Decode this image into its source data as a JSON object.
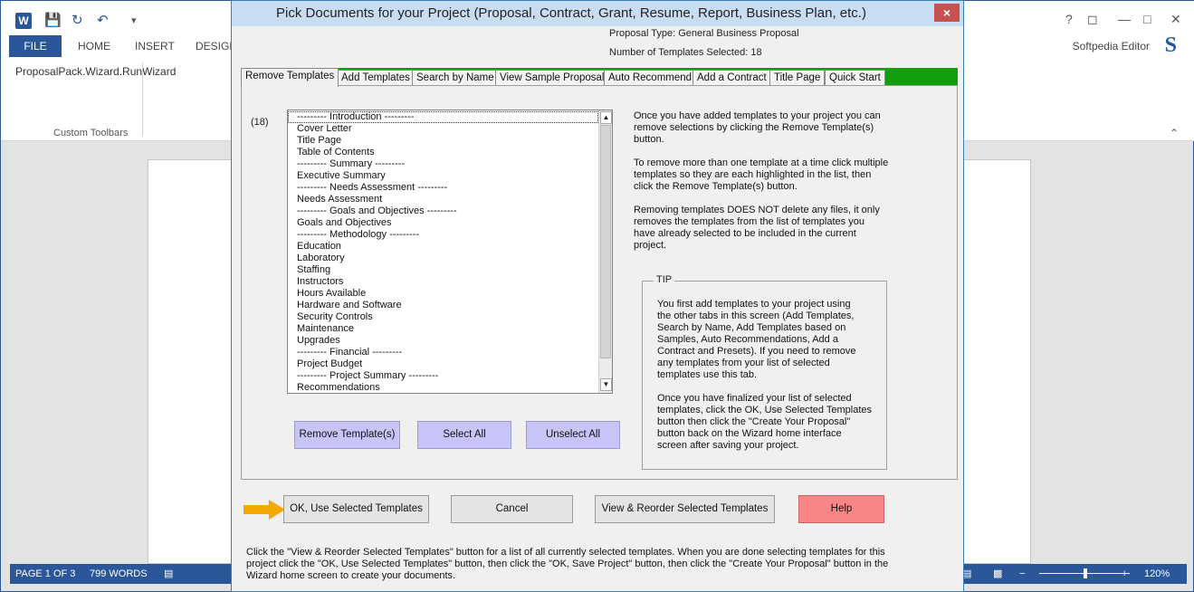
{
  "word": {
    "tabs": [
      "FILE",
      "HOME",
      "INSERT",
      "DESIGN"
    ],
    "user_name": "Softpedia Editor",
    "s_logo": "S",
    "toolbar_item": "ProposalPack.Wizard.RunWizard",
    "group_label": "Custom Toolbars",
    "status": {
      "page": "PAGE 1 OF 3",
      "words": "799 WORDS",
      "zoom": "120%"
    }
  },
  "dialog": {
    "title": "Pick Documents for your Project (Proposal, Contract, Grant, Resume, Report, Business Plan, etc.)",
    "close_label": "×",
    "proposal_type": "Proposal Type: General Business Proposal",
    "templates_selected": "Number of Templates Selected: 18",
    "tabs": [
      "Remove Templates",
      "Add Templates",
      "Search by Name",
      "View Sample Proposals",
      "Auto Recommend",
      "Add a Contract",
      "Title Page",
      "Quick Start"
    ],
    "count_label": "(18)",
    "list_items": [
      "--------- Introduction ---------",
      "Cover Letter",
      "Title Page",
      "Table of Contents",
      "--------- Summary ---------",
      "Executive Summary",
      "--------- Needs Assessment ---------",
      "Needs Assessment",
      "--------- Goals and Objectives ---------",
      "Goals and Objectives",
      "--------- Methodology ---------",
      "Education",
      "Laboratory",
      "Staffing",
      "Instructors",
      "Hours Available",
      "Hardware and Software",
      "Security Controls",
      "Maintenance",
      "Upgrades",
      "--------- Financial ---------",
      "Project Budget",
      "--------- Project Summary ---------",
      "Recommendations"
    ],
    "buttons": {
      "remove": "Remove Template(s)",
      "select_all": "Select All",
      "unselect_all": "Unselect All"
    },
    "help_paragraphs": [
      [
        "Once you have added templates to your project you can",
        "remove selections by clicking the Remove Template(s)",
        "button."
      ],
      [
        "To remove more than one template at a time click multiple",
        "templates so they are each highlighted in the list, then",
        "click the Remove Template(s) button."
      ],
      [
        "Removing templates DOES NOT delete any files, it only",
        "removes the templates from the list of templates you",
        "have already selected to be included in the current",
        "project."
      ]
    ],
    "tip": {
      "legend": "TIP",
      "paragraphs": [
        [
          "You first add templates to your project using",
          "the other tabs in this screen (Add Templates,",
          "Search by Name, Add Templates based on",
          "Samples, Auto Recommendations, Add a",
          "Contract and Presets). If you need to remove",
          "any templates from your list of selected",
          "templates use this tab."
        ],
        [
          "Once you have finalized your list of selected",
          "templates, click the OK, Use Selected Templates",
          "button then click the \"Create Your Proposal\"",
          "button back on the Wizard home interface",
          "screen after saving your project."
        ]
      ]
    },
    "bottom_buttons": {
      "ok": "OK, Use Selected Templates",
      "cancel": "Cancel",
      "view_reorder": "View & Reorder Selected Templates",
      "help": "Help"
    },
    "footer_lines": [
      "Click the \"View & Reorder Selected Templates\" button for a list of all currently selected templates.  When you are done selecting templates for this",
      "project click the \"OK, Use Selected Templates\" button, then click the \"OK, Save Project\" button, then click the \"Create Your Proposal\" button in the",
      "Wizard home screen to create your documents."
    ],
    "colors": {
      "tabstrip": "#119f0f",
      "purple_button": "#c7c5f7",
      "help_button": "#f88686",
      "arrow": "#f5a800"
    }
  }
}
